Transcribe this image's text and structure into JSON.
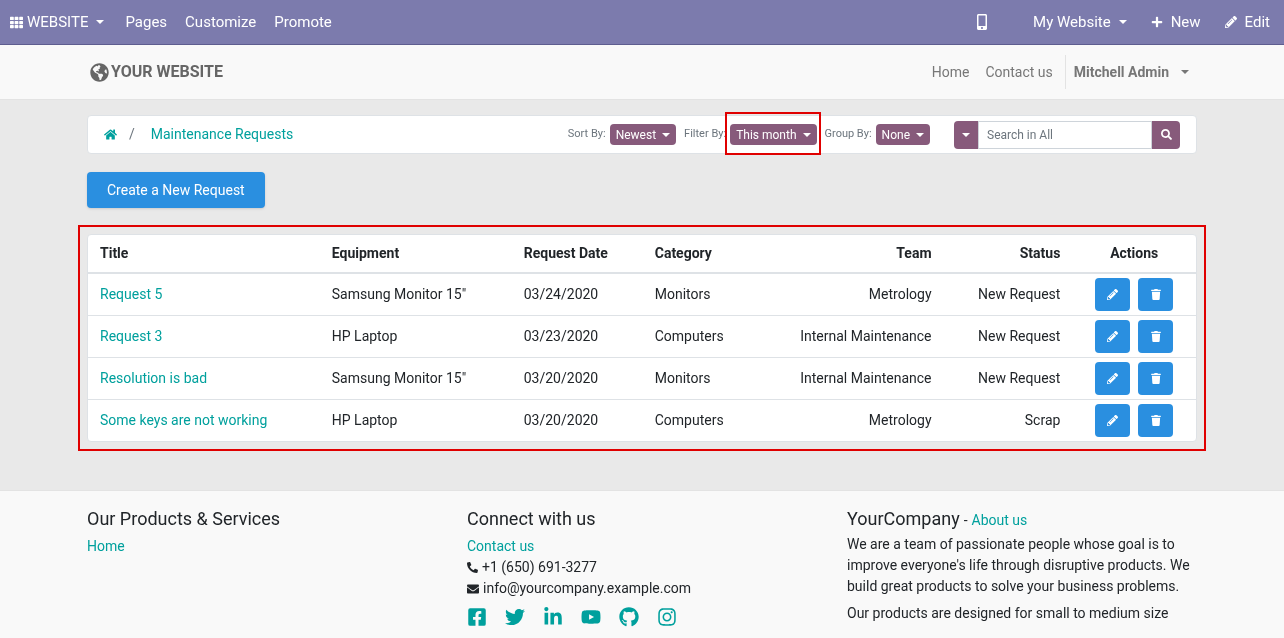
{
  "top_bar": {
    "app_menu": "WEBSITE",
    "items": [
      "Pages",
      "Customize",
      "Promote"
    ],
    "website_menu": "My Website",
    "new_button": "New",
    "edit_button": "Edit"
  },
  "header": {
    "logo": "YOUR WEBSITE",
    "nav": [
      "Home",
      "Contact us"
    ],
    "user": "Mitchell Admin"
  },
  "breadcrumb": {
    "separator": "/",
    "current": "Maintenance Requests"
  },
  "controls": [
    {
      "label": "Sort By:",
      "value": "Newest",
      "highlighted": false
    },
    {
      "label": "Filter By:",
      "value": "This month",
      "highlighted": true
    },
    {
      "label": "Group By:",
      "value": "None",
      "highlighted": false
    }
  ],
  "search": {
    "placeholder": "Search in All"
  },
  "create_button": "Create a New Request",
  "table": {
    "highlighted": true,
    "columns": [
      "Title",
      "Equipment",
      "Request Date",
      "Category",
      "Team",
      "Status",
      "Actions"
    ],
    "rows": [
      {
        "title": "Request 5",
        "equipment": "Samsung Monitor 15\"",
        "date": "03/24/2020",
        "category": "Monitors",
        "team": "Metrology",
        "status": "New Request"
      },
      {
        "title": "Request 3",
        "equipment": "HP Laptop",
        "date": "03/23/2020",
        "category": "Computers",
        "team": "Internal Maintenance",
        "status": "New Request"
      },
      {
        "title": "Resolution is bad",
        "equipment": "Samsung Monitor 15\"",
        "date": "03/20/2020",
        "category": "Monitors",
        "team": "Internal Maintenance",
        "status": "New Request"
      },
      {
        "title": "Some keys are not working",
        "equipment": "HP Laptop",
        "date": "03/20/2020",
        "category": "Computers",
        "team": "Metrology",
        "status": "Scrap"
      }
    ]
  },
  "footer": {
    "products": {
      "heading": "Our Products & Services",
      "links": [
        "Home"
      ]
    },
    "connect": {
      "heading": "Connect with us",
      "link": "Contact us",
      "phone": "+1 (650) 691-3277",
      "email": "info@yourcompany.example.com"
    },
    "company": {
      "heading": "YourCompany",
      "separator": "-",
      "link": "About us",
      "paragraphs": [
        "We are a team of passionate people whose goal is to improve everyone's life through disruptive products. We build great products to solve your business problems.",
        "Our products are designed for small to medium size"
      ]
    }
  }
}
